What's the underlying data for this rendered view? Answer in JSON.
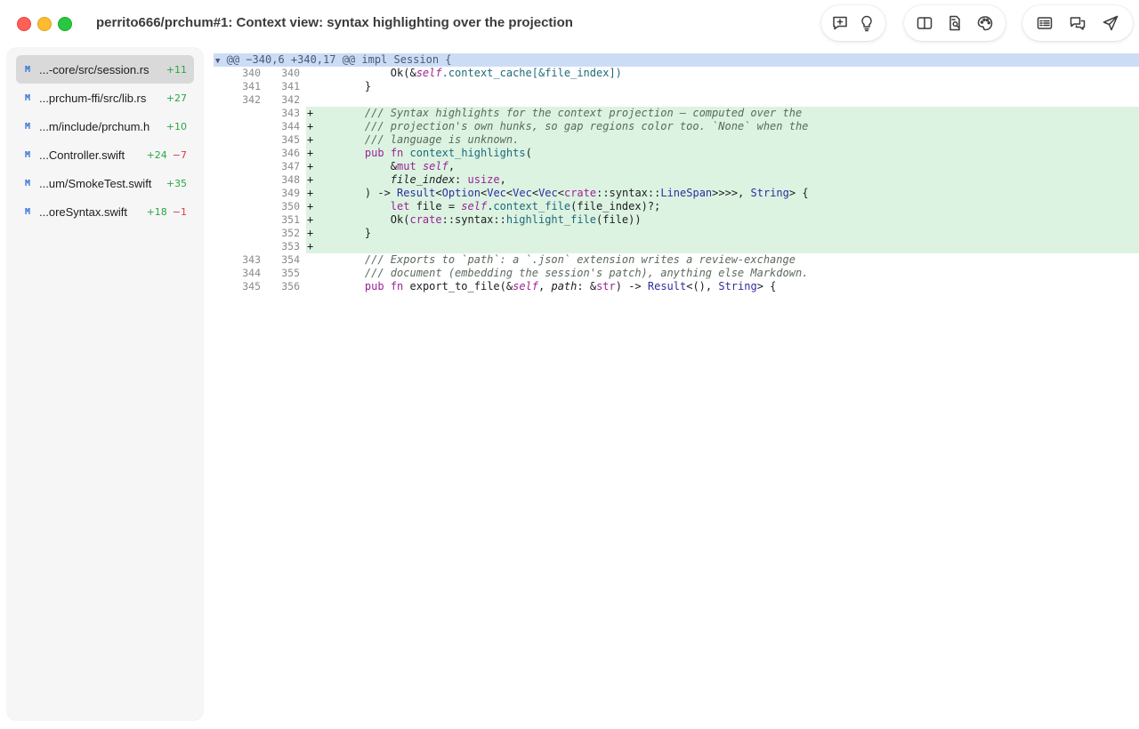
{
  "window": {
    "title": "perrito666/prchum#1: Context view: syntax highlighting over the projection"
  },
  "toolbar": {
    "groups": [
      [
        "add-comment-icon",
        "lightbulb-icon"
      ],
      [
        "split-view-icon",
        "document-search-icon",
        "palette-icon"
      ],
      [
        "list-view-icon",
        "conversation-icon",
        "send-icon"
      ]
    ]
  },
  "sidebar": {
    "files": [
      {
        "status": "M",
        "name": "...-core/src/session.rs",
        "additions": "+11",
        "deletions": ""
      },
      {
        "status": "M",
        "name": "...prchum-ffi/src/lib.rs",
        "additions": "+27",
        "deletions": ""
      },
      {
        "status": "M",
        "name": "...m/include/prchum.h",
        "additions": "+10",
        "deletions": ""
      },
      {
        "status": "M",
        "name": "...Controller.swift",
        "additions": "+24",
        "deletions": "−7"
      },
      {
        "status": "M",
        "name": "...um/SmokeTest.swift",
        "additions": "+35",
        "deletions": ""
      },
      {
        "status": "M",
        "name": "...oreSyntax.swift",
        "additions": "+18",
        "deletions": "−1"
      }
    ]
  },
  "diff": {
    "hunk_header": "@@ −340,6 +340,17 @@ impl Session {",
    "hunk_toggle": "▼",
    "lines": [
      {
        "old": "340",
        "new": "340",
        "marker": "",
        "added": false
      },
      {
        "old": "341",
        "new": "341",
        "marker": "",
        "added": false
      },
      {
        "old": "342",
        "new": "342",
        "marker": "",
        "added": false
      },
      {
        "old": "",
        "new": "343",
        "marker": "+",
        "added": true
      },
      {
        "old": "",
        "new": "344",
        "marker": "+",
        "added": true
      },
      {
        "old": "",
        "new": "345",
        "marker": "+",
        "added": true
      },
      {
        "old": "",
        "new": "346",
        "marker": "+",
        "added": true
      },
      {
        "old": "",
        "new": "347",
        "marker": "+",
        "added": true
      },
      {
        "old": "",
        "new": "348",
        "marker": "+",
        "added": true
      },
      {
        "old": "",
        "new": "349",
        "marker": "+",
        "added": true
      },
      {
        "old": "",
        "new": "350",
        "marker": "+",
        "added": true
      },
      {
        "old": "",
        "new": "351",
        "marker": "+",
        "added": true
      },
      {
        "old": "",
        "new": "352",
        "marker": "+",
        "added": true
      },
      {
        "old": "",
        "new": "353",
        "marker": "+",
        "added": true
      },
      {
        "old": "343",
        "new": "354",
        "marker": "",
        "added": false
      },
      {
        "old": "344",
        "new": "355",
        "marker": "",
        "added": false
      },
      {
        "old": "345",
        "new": "356",
        "marker": "",
        "added": false
      }
    ],
    "code": {
      "l340": [
        "        Ok(&",
        "self",
        ".context_cache[&file_index])"
      ],
      "l341": "    }",
      "l342": "",
      "l343": "    /// Syntax highlights for the context projection — computed over the",
      "l344": "    /// projection's own hunks, so gap regions color too. `None` when the",
      "l345": "    /// language is unknown.",
      "l346": [
        "    ",
        "pub",
        " ",
        "fn",
        " ",
        "context_highlights",
        "("
      ],
      "l347": [
        "        &",
        "mut",
        " ",
        "self",
        ","
      ],
      "l348": [
        "        ",
        "file_index",
        ": ",
        "usize",
        ","
      ],
      "l349": [
        "    ) -> ",
        "Result",
        "<",
        "Option",
        "<",
        "Vec",
        "<",
        "Vec",
        "<",
        "Vec",
        "<",
        "crate",
        "::syntax::",
        "LineSpan",
        ">>>>, ",
        "String",
        "> {"
      ],
      "l350": [
        "        ",
        "let",
        " file = ",
        "self",
        ".",
        "context_file",
        "(file_index)?;"
      ],
      "l351": [
        "        Ok(",
        "crate",
        "::syntax::",
        "highlight_file",
        "(file))"
      ],
      "l352": "    }",
      "l353": "",
      "l354": "    /// Exports to `path`: a `.json` extension writes a review-exchange",
      "l355": "    /// document (embedding the session's patch), anything else Markdown.",
      "l356": [
        "    ",
        "pub",
        " ",
        "fn",
        " export_to_file(&",
        "self",
        ", ",
        "path",
        ": &",
        "str",
        ") -> ",
        "Result",
        "<(), ",
        "String",
        "> {"
      ]
    }
  },
  "colors": {
    "hunk_bg": "#ccdcf5",
    "added_bg": "#dcf3e2",
    "additions": "#27a745",
    "deletions": "#d73a49",
    "status_modified": "#2e6fd8",
    "keyword": "#9b2393",
    "type": "#2d2da0",
    "function": "#1d6a78",
    "comment": "#5b6a5d"
  }
}
